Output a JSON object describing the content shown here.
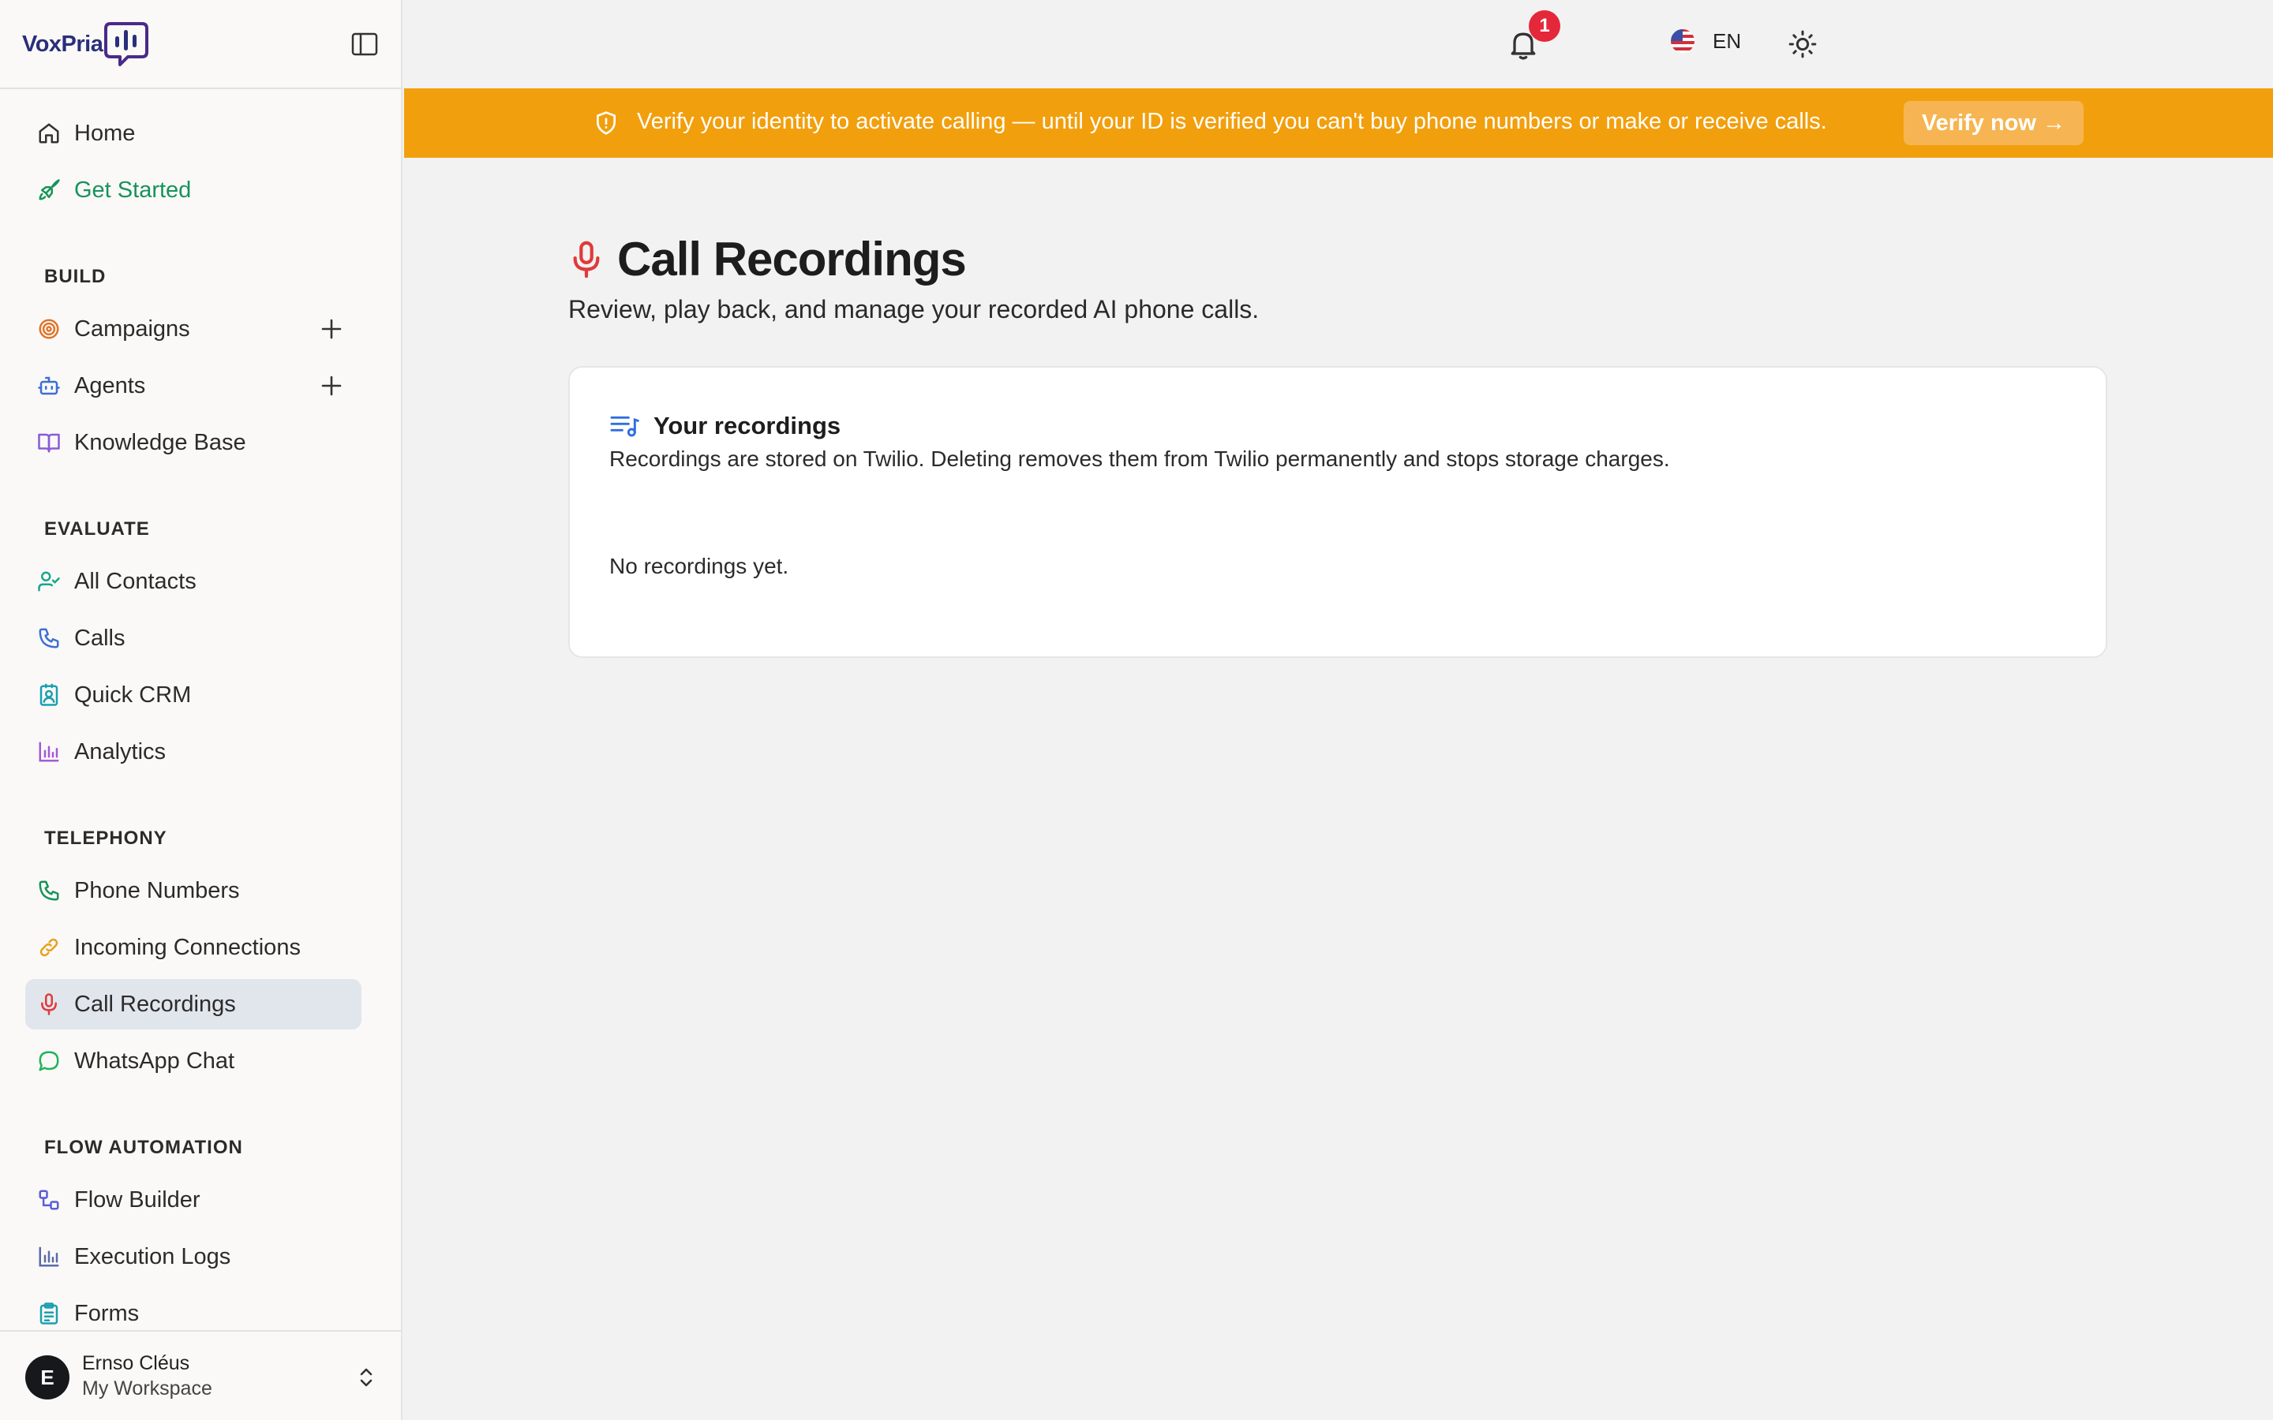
{
  "brand": {
    "name": "VoxPria"
  },
  "sidebar": {
    "items_top": [
      {
        "label": "Home",
        "icon": "home-icon"
      },
      {
        "label": "Get Started",
        "icon": "rocket-icon"
      }
    ],
    "sections": {
      "build": "BUILD",
      "evaluate": "EVALUATE",
      "telephony": "TELEPHONY",
      "flow": "FLOW AUTOMATION"
    },
    "build": [
      {
        "label": "Campaigns",
        "icon": "target-icon"
      },
      {
        "label": "Agents",
        "icon": "bot-icon"
      },
      {
        "label": "Knowledge Base",
        "icon": "book-icon"
      }
    ],
    "evaluate": [
      {
        "label": "All Contacts",
        "icon": "user-check-icon"
      },
      {
        "label": "Calls",
        "icon": "phone-icon"
      },
      {
        "label": "Quick CRM",
        "icon": "contact-card-icon"
      },
      {
        "label": "Analytics",
        "icon": "bar-chart-icon"
      }
    ],
    "telephony": [
      {
        "label": "Phone Numbers",
        "icon": "phone-icon"
      },
      {
        "label": "Incoming Connections",
        "icon": "link-icon"
      },
      {
        "label": "Call Recordings",
        "icon": "mic-icon"
      },
      {
        "label": "WhatsApp Chat",
        "icon": "chat-icon"
      }
    ],
    "flow": [
      {
        "label": "Flow Builder",
        "icon": "workflow-icon"
      },
      {
        "label": "Execution Logs",
        "icon": "bar-chart-icon"
      },
      {
        "label": "Forms",
        "icon": "clipboard-icon"
      }
    ],
    "footer": {
      "avatar_initial": "E",
      "user_name": "Ernso Cléus",
      "workspace": "My Workspace"
    }
  },
  "topbar": {
    "notification_count": "1",
    "language": "EN"
  },
  "banner": {
    "message": "Verify your identity to activate calling — until your ID is verified you can't buy phone numbers or make or receive calls.",
    "button_label": "Verify now →"
  },
  "page": {
    "title": "Call Recordings",
    "subtitle": "Review, play back, and manage your recorded AI phone calls."
  },
  "recordings_card": {
    "title": "Your recordings",
    "description": "Recordings are stored on Twilio. Deleting removes them from Twilio permanently and stops storage charges.",
    "empty_text": "No recordings yet."
  },
  "colors": {
    "accent_green": "#18935a",
    "banner": "#f29f0d",
    "active_bg": "#e1e5ec",
    "badge": "#e5273a",
    "mic": "#e03a3a"
  }
}
